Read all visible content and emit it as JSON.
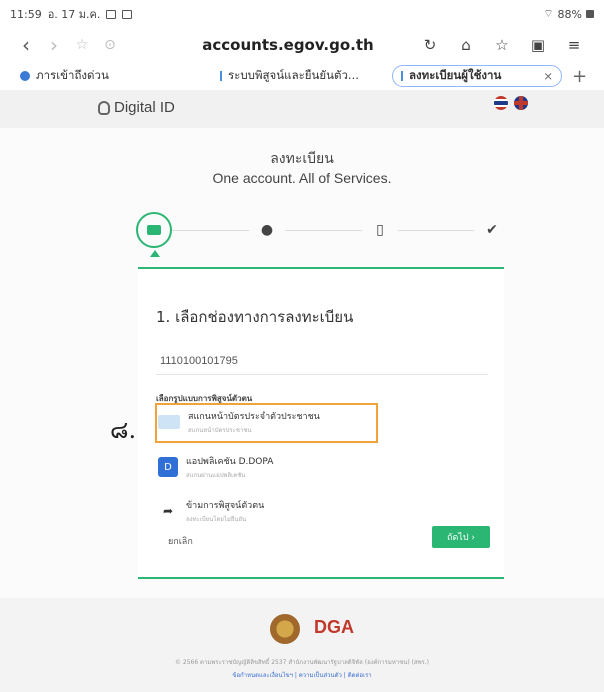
{
  "statusbar": {
    "time": "11:59",
    "date": "อ. 17 ม.ค.",
    "battery": "88%"
  },
  "addressbar": {
    "url": "accounts.egov.go.th",
    "back_icon": "back-arrow-icon",
    "forward_icon": "forward-arrow-icon"
  },
  "tabs": {
    "bookmark_label": "ภารเข้าถึงด่วน",
    "items": [
      {
        "label": "ระบบพิสูจน์และยืนยันตัว..."
      },
      {
        "label": "ลงทะเบียนผู้ใช้งาน"
      }
    ],
    "close_glyph": "×",
    "new_tab_glyph": "+"
  },
  "header": {
    "logo_text": "Digital ID"
  },
  "page": {
    "title_th": "ลงทะเบียน",
    "title_en": "One account. All of Services."
  },
  "card": {
    "heading": "1. เลือกช่องทางการลงทะเบียน",
    "id_value": "1110100101795",
    "choose_label": "เลือกรูปแบบการพิสูจน์ตัวตน",
    "options": [
      {
        "label": "สแกนหน้าบัตรประจำตัวประชาชน",
        "sub": "สแกนหน้าบัตรประชาชน"
      },
      {
        "label": "แอปพลิเคชัน D.DOPA",
        "sub": "สแกนผ่านแอปพลิเคชัน",
        "icon_letter": "D"
      },
      {
        "label": "ข้ามการพิสูจน์ตัวตน",
        "sub": "ลงทะเบียนโดยไม่ยืนยัน"
      }
    ],
    "cancel_label": "ยกเลิก",
    "next_label": "ถัดไป ›"
  },
  "annotation": "๘.",
  "footer": {
    "org_logo": "DGA",
    "copyright": "© 2566 ตามพระราชบัญญัติลิขสิทธิ์ 2537 สำนักงานพัฒนารัฐบาลดิจิทัล (องค์การมหาชน) (สพร.)",
    "link_terms": "ข้อกำหนดและเงื่อนไขฯ",
    "link_privacy": "ความเป็นส่วนตัว",
    "link_contact": "ติดต่อเรา"
  }
}
